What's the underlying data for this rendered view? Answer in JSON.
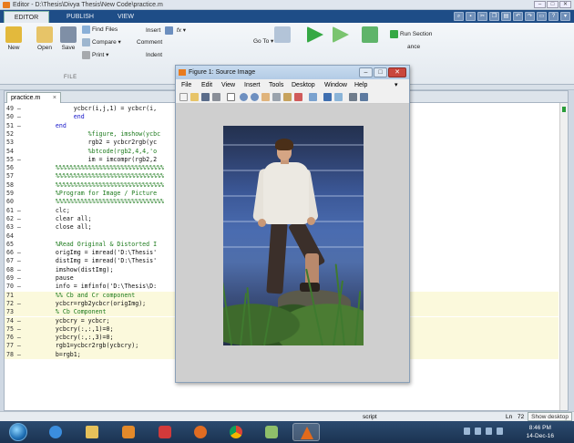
{
  "window": {
    "title": "Editor - D:\\Thesis\\Divya Thesis\\New Code\\practice.m",
    "controls": [
      "–",
      "□",
      "✕"
    ]
  },
  "ribbon": {
    "tabs": [
      {
        "label": "EDITOR",
        "active": true
      },
      {
        "label": "PUBLISH",
        "active": false
      },
      {
        "label": "VIEW",
        "active": false
      }
    ],
    "file_group": {
      "new": "New",
      "open": "Open",
      "save": "Save",
      "find_files": "Find Files",
      "compare": "Compare",
      "print": "Print",
      "label": "FILE"
    },
    "edit_group": {
      "insert": "Insert",
      "comment": "Comment",
      "indent": "Indent",
      "fx": "fx"
    },
    "navigate_group": {
      "go_to": "Go To"
    },
    "run_group": {
      "run_section": "Run Section",
      "advance": "ance"
    }
  },
  "editor": {
    "tab_label": "practice.m",
    "tab_close": "×",
    "lines": [
      {
        "n": "49 –",
        "t": "        ycbcr(i,j,1) = ycbcr(i,",
        "c": "plain",
        "hl": false
      },
      {
        "n": "50 –",
        "t": "        end",
        "c": "kw",
        "hl": false
      },
      {
        "n": "51 –",
        "t": "   end",
        "c": "kw",
        "hl": false
      },
      {
        "n": "52",
        "t": "            %figure, imshow(ycbc",
        "c": "cmt",
        "hl": false
      },
      {
        "n": "53",
        "t": "            rgb2 = ycbcr2rgb(yc",
        "c": "plain",
        "hl": false
      },
      {
        "n": "54",
        "t": "            %btcode(rgb2,4,4,'o",
        "c": "cmt",
        "hl": false
      },
      {
        "n": "55 –",
        "t": "            im = imcompr(rgb2,2",
        "c": "plain",
        "hl": false
      },
      {
        "n": "56",
        "t": "   %%%%%%%%%%%%%%%%%%%%%%%%%%%%%%",
        "c": "cmt",
        "hl": false
      },
      {
        "n": "57",
        "t": "   %%%%%%%%%%%%%%%%%%%%%%%%%%%%%%",
        "c": "cmt",
        "hl": false
      },
      {
        "n": "58",
        "t": "   %%%%%%%%%%%%%%%%%%%%%%%%%%%%%%",
        "c": "cmt",
        "hl": false
      },
      {
        "n": "59",
        "t": "   %Program for Image / Picture",
        "c": "cmt",
        "hl": false
      },
      {
        "n": "60",
        "t": "   %%%%%%%%%%%%%%%%%%%%%%%%%%%%%%",
        "c": "cmt",
        "hl": false
      },
      {
        "n": "61 –",
        "t": "   clc;",
        "c": "plain",
        "hl": false
      },
      {
        "n": "62 –",
        "t": "   clear all;",
        "c": "plain",
        "hl": false
      },
      {
        "n": "63 –",
        "t": "   close all;",
        "c": "plain",
        "hl": false
      },
      {
        "n": "64",
        "t": "",
        "c": "plain",
        "hl": false
      },
      {
        "n": "65",
        "t": "   %Read Original & Distorted I",
        "c": "cmt",
        "hl": false
      },
      {
        "n": "66 –",
        "t": "   origImg = imread('D:\\Thesis'",
        "c": "plain",
        "hl": false
      },
      {
        "n": "67 –",
        "t": "   distImg = imread('D:\\Thesis'",
        "c": "plain",
        "hl": false
      },
      {
        "n": "68 –",
        "t": "   imshow(distImg);",
        "c": "plain",
        "hl": false
      },
      {
        "n": "69 –",
        "t": "   pause",
        "c": "plain",
        "hl": false
      },
      {
        "n": "70 –",
        "t": "   info = imfinfo('D:\\Thesis\\D:",
        "c": "plain",
        "hl": false
      },
      {
        "n": "71",
        "t": "   %% Cb and Cr component",
        "c": "cmt",
        "hl": true
      },
      {
        "n": "72 –",
        "t": "   ycbcr=rgb2ycbcr(origImg);",
        "c": "plain",
        "hl": true
      },
      {
        "n": "73",
        "t": "   % Cb Component",
        "c": "cmt",
        "hl": true
      },
      {
        "n": "74 –",
        "t": "   ycbcry = ycbcr;",
        "c": "plain",
        "hl": true
      },
      {
        "n": "75 –",
        "t": "   ycbcry(:,:,1)=0;",
        "c": "plain",
        "hl": true
      },
      {
        "n": "76 –",
        "t": "   ycbcry(:,:,3)=0;",
        "c": "plain",
        "hl": true
      },
      {
        "n": "77 –",
        "t": "   rgb1=ycbcr2rgb(ycbcry);",
        "c": "plain",
        "hl": true
      },
      {
        "n": "78 –",
        "t": "   b=rgb1;",
        "c": "plain",
        "hl": true
      }
    ],
    "hidden_fragment": "VD"
  },
  "status": {
    "mode": "script",
    "ln_label": "Ln",
    "ln_value": "72",
    "show_desktop": "Show desktop"
  },
  "figure": {
    "title": "Figure 1: Source Image",
    "menu": [
      "File",
      "Edit",
      "View",
      "Insert",
      "Tools",
      "Desktop",
      "Window",
      "Help"
    ],
    "menu_more": "▾"
  },
  "taskbar": {
    "time": "8:46 PM",
    "date": "14-Dec-16"
  },
  "colors": {
    "ribbon_tab_bg": "#1e4d87",
    "comment": "#1c7a1c",
    "keyword": "#1313c8",
    "highlight": "#fbf9dc"
  }
}
